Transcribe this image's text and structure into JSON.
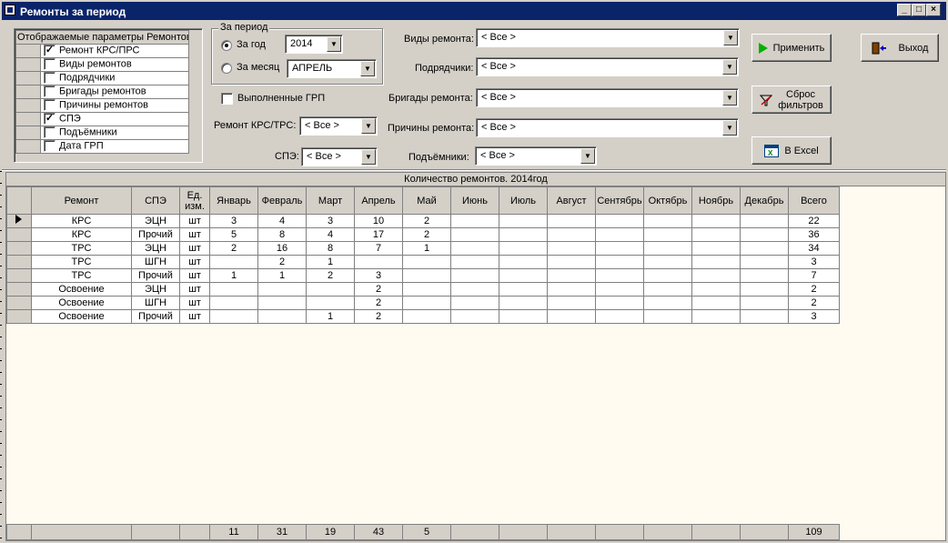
{
  "window": {
    "title": "Ремонты за период",
    "min": "_",
    "max": "□",
    "close": "×"
  },
  "params": {
    "header": "Отображаемые параметры Ремонтов",
    "items": [
      {
        "label": "Ремонт КРС/ПРС",
        "checked": true
      },
      {
        "label": "Виды ремонтов",
        "checked": false
      },
      {
        "label": "Подрядчики",
        "checked": false
      },
      {
        "label": "Бригады ремонтов",
        "checked": false
      },
      {
        "label": "Причины ремонтов",
        "checked": false
      },
      {
        "label": "СПЭ",
        "checked": true
      },
      {
        "label": "Подъёмники",
        "checked": false
      },
      {
        "label": "Дата ГРП",
        "checked": false
      }
    ]
  },
  "period": {
    "legend": "За период",
    "year_label": "За год",
    "year_value": "2014",
    "month_label": "За месяц",
    "month_value": "АПРЕЛЬ"
  },
  "grp_label": "Выполненные ГРП",
  "filters": {
    "krs_label": "Ремонт КРС/ТРС:",
    "krs_value": "< Все >",
    "spe_label": "СПЭ:",
    "spe_value": "< Все >",
    "types_label": "Виды ремонта:",
    "types_value": "< Все >",
    "contractors_label": "Подрядчики:",
    "contractors_value": "< Все >",
    "brigades_label": "Бригады ремонта:",
    "brigades_value": "< Все >",
    "reasons_label": "Причины ремонта:",
    "reasons_value": "< Все >",
    "lifts_label": "Подъёмники:",
    "lifts_value": "< Все >"
  },
  "buttons": {
    "apply": "Применить",
    "exit": "Выход",
    "reset_line1": "Сброс",
    "reset_line2": "фильтров",
    "excel": "В Excel"
  },
  "grid": {
    "caption": "Количество ремонтов. 2014год",
    "columns": [
      "Ремонт",
      "СПЭ",
      "Ед. изм.",
      "Январь",
      "Февраль",
      "Март",
      "Апрель",
      "Май",
      "Июнь",
      "Июль",
      "Август",
      "Сентябрь",
      "Октябрь",
      "Ноябрь",
      "Декабрь",
      "Всего"
    ],
    "rows": [
      [
        "КРС",
        "ЭЦН",
        "шт",
        "3",
        "4",
        "3",
        "10",
        "2",
        "",
        "",
        "",
        "",
        "",
        "",
        "",
        "22"
      ],
      [
        "КРС",
        "Прочий",
        "шт",
        "5",
        "8",
        "4",
        "17",
        "2",
        "",
        "",
        "",
        "",
        "",
        "",
        "",
        "36"
      ],
      [
        "ТРС",
        "ЭЦН",
        "шт",
        "2",
        "16",
        "8",
        "7",
        "1",
        "",
        "",
        "",
        "",
        "",
        "",
        "",
        "34"
      ],
      [
        "ТРС",
        "ШГН",
        "шт",
        "",
        "2",
        "1",
        "",
        "",
        "",
        "",
        "",
        "",
        "",
        "",
        "",
        "3"
      ],
      [
        "ТРС",
        "Прочий",
        "шт",
        "1",
        "1",
        "2",
        "3",
        "",
        "",
        "",
        "",
        "",
        "",
        "",
        "",
        "7"
      ],
      [
        "Освоение",
        "ЭЦН",
        "шт",
        "",
        "",
        "",
        "2",
        "",
        "",
        "",
        "",
        "",
        "",
        "",
        "",
        "2"
      ],
      [
        "Освоение",
        "ШГН",
        "шт",
        "",
        "",
        "",
        "2",
        "",
        "",
        "",
        "",
        "",
        "",
        "",
        "",
        "2"
      ],
      [
        "Освоение",
        "Прочий",
        "шт",
        "",
        "",
        "1",
        "2",
        "",
        "",
        "",
        "",
        "",
        "",
        "",
        "",
        "3"
      ]
    ],
    "footer": [
      "",
      "",
      "",
      "11",
      "31",
      "19",
      "43",
      "5",
      "",
      "",
      "",
      "",
      "",
      "",
      "",
      "109"
    ]
  }
}
